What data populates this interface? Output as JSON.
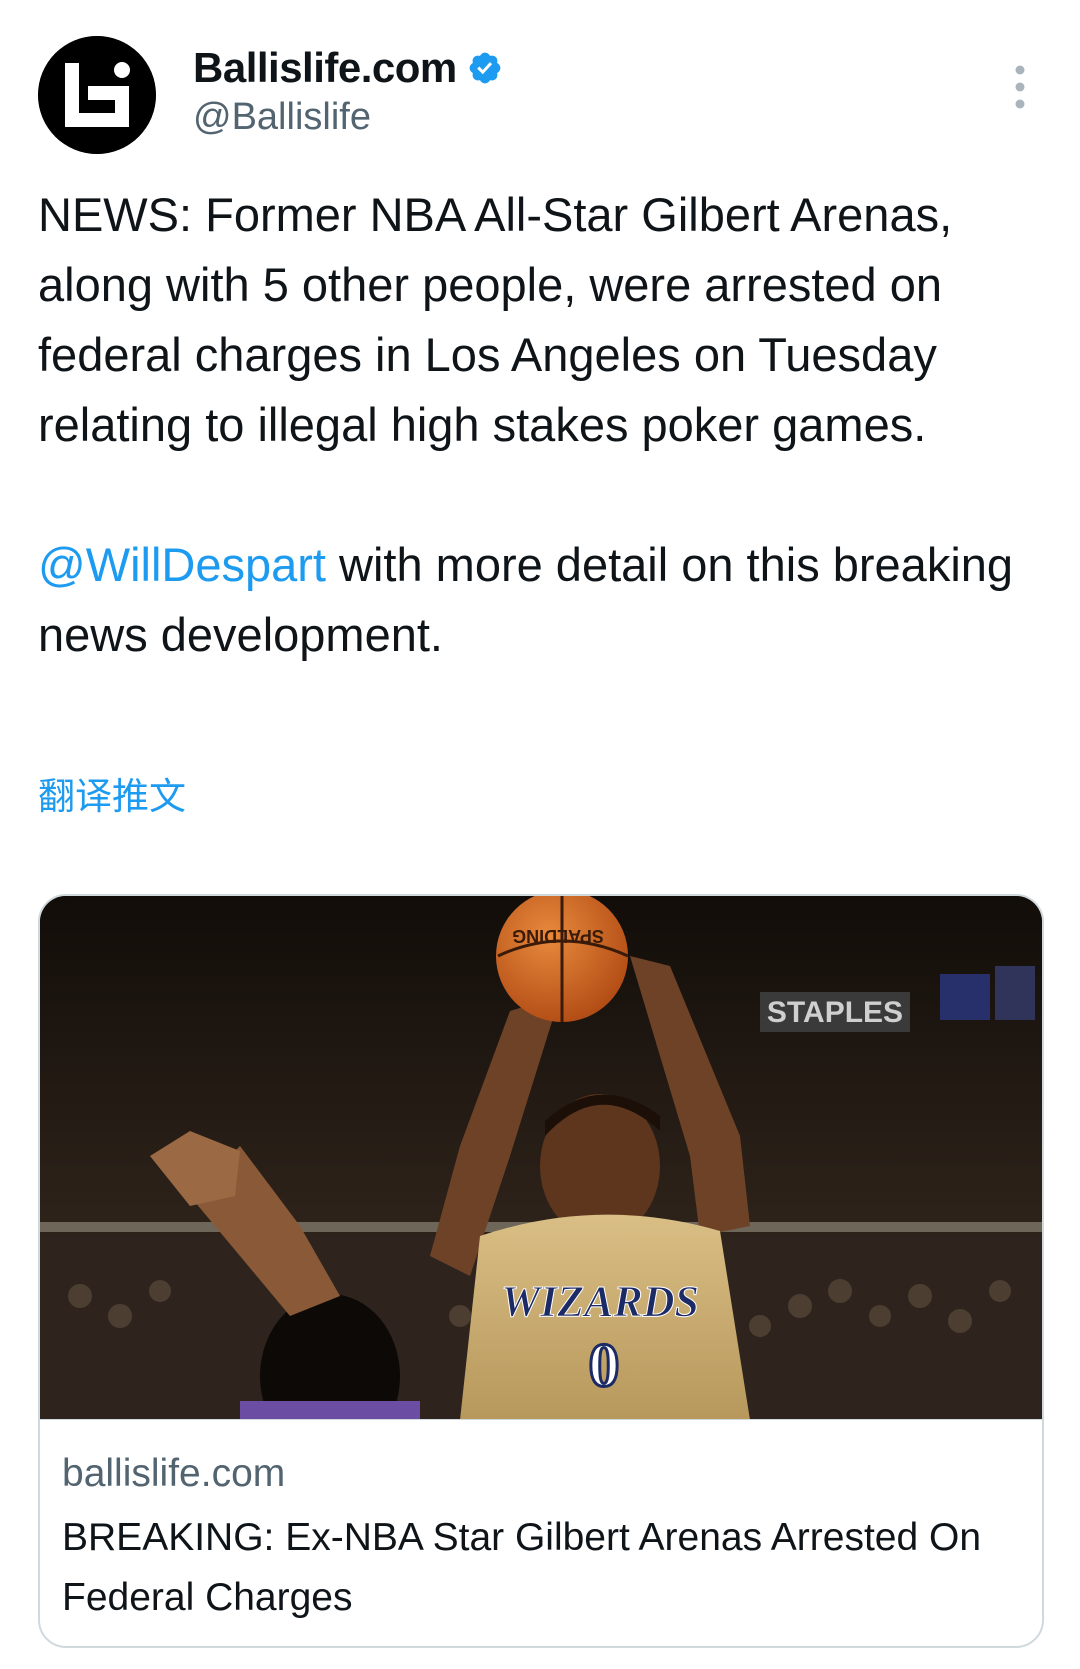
{
  "author": {
    "display_name": "Ballislife.com",
    "handle": "@Ballislife",
    "avatar_icon": "ballislife-logo-icon",
    "verified_icon": "verified-badge-icon",
    "verified_color": "#1d9bf0"
  },
  "tweet": {
    "paragraph1": "NEWS: Former NBA All-Star Gilbert Arenas, along with 5 other people, were arrested on federal charges in Los Angeles on Tuesday relating to illegal high stakes poker games.",
    "mention": "@WillDespart",
    "paragraph2_rest": " with more detail on this breaking news development.",
    "translate_label": "翻译推文"
  },
  "card": {
    "image_texts": {
      "ball_brand": "SPALDING",
      "arena_sign": "STAPLES",
      "jersey_text": "WIZARDS",
      "jersey_number": "0"
    },
    "domain": "ballislife.com",
    "title": "BREAKING: Ex-NBA Star Gilbert Arenas Arrested On Federal Charges"
  },
  "colors": {
    "link": "#1d9bf0",
    "secondary_text": "#536471",
    "border": "#cfd9de"
  }
}
